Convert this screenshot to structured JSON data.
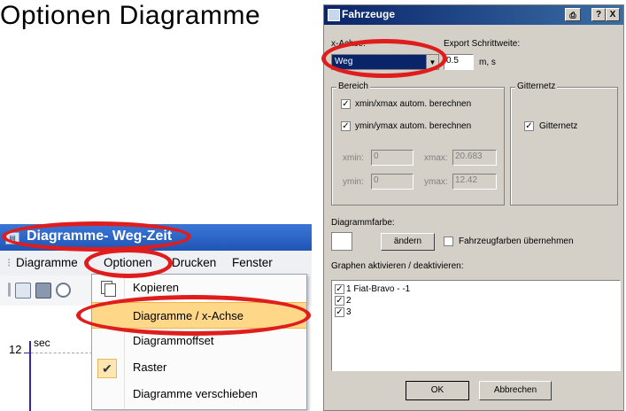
{
  "heading": "Optionen Diagramme",
  "app": {
    "title": "Diagramme- Weg-Zeit",
    "menu": [
      "Diagramme",
      "Optionen",
      "Drucken",
      "Fenster"
    ],
    "chart": {
      "y_tick": "12",
      "y_unit": "sec"
    },
    "dropdown": [
      {
        "label": "Kopieren",
        "icon": "copy-icon"
      },
      {
        "label": "Diagramme / x-Achse",
        "highlighted": true
      },
      {
        "label": "Diagrammoffset"
      },
      {
        "label": "Raster",
        "checked": true
      },
      {
        "label": "Diagramme verschieben"
      }
    ]
  },
  "dialog": {
    "title": "Fahrzeuge",
    "title_buttons": [
      "?",
      "X"
    ],
    "x_achse_label": "x-Achse:",
    "x_achse_value": "Weg",
    "export_label": "Export Schrittweite:",
    "export_value": "0.5",
    "export_unit": "m, s",
    "bereich": {
      "title": "Bereich",
      "cb1": "xmin/xmax autom. berechnen",
      "cb2": "ymin/ymax autom. berechnen",
      "xmin_label": "xmin:",
      "xmin": "0",
      "xmax_label": "xmax:",
      "xmax": "20.683",
      "ymin_label": "ymin:",
      "ymin": "0",
      "ymax_label": "ymax:",
      "ymax": "12.42"
    },
    "gitternetz": {
      "title": "Gitternetz",
      "cb": "Gitternetz"
    },
    "farbe_label": "Diagrammfarbe:",
    "aendern": "ändern",
    "fahrzeugfarben": "Fahrzeugfarben übernehmen",
    "graphen_label": "Graphen aktivieren / deaktivieren:",
    "graphen": [
      "1 Fiat-Bravo - -1",
      "2",
      "3"
    ],
    "ok": "OK",
    "abbrechen": "Abbrechen"
  },
  "colors": {
    "highlight": "#ffd788",
    "annotation": "#e01d1d",
    "title_bar": "#0a246a"
  }
}
